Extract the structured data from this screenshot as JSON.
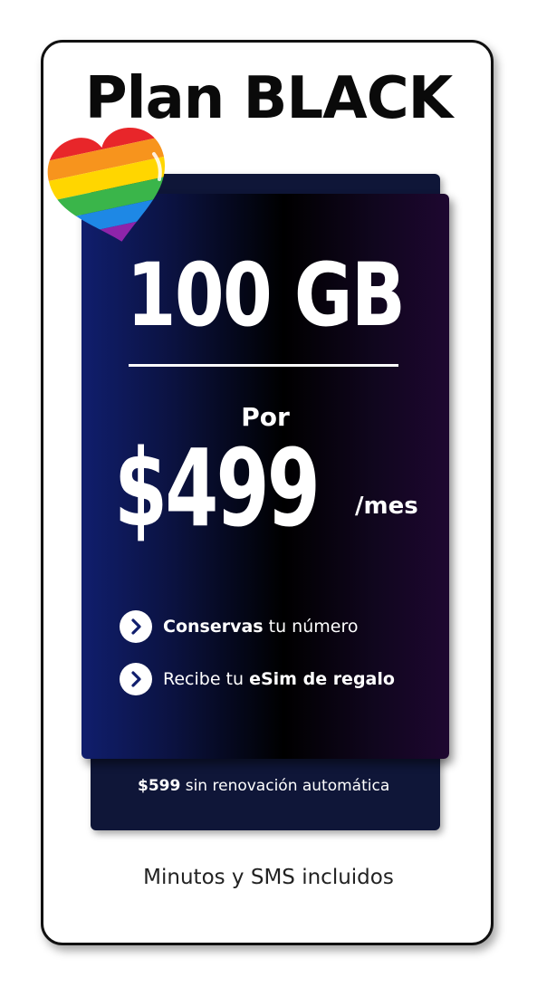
{
  "plan": {
    "title": "Plan BLACK",
    "data_amount": "100 GB",
    "price_prefix": "Por",
    "price": "$499",
    "price_period": "/mes",
    "features": [
      {
        "bold": "Conservas",
        "rest": " tu número",
        "icon": "chevron-right-icon"
      },
      {
        "pre": "Recibe tu ",
        "bold": "eSim de regalo",
        "icon": "chevron-right-icon"
      }
    ],
    "renewal": {
      "price": "$599",
      "text": " sin renovación automática"
    },
    "footer": "Minutos y SMS incluidos"
  },
  "badge": {
    "icon": "rainbow-heart-icon"
  },
  "colors": {
    "panel_gradient_start": "#101e6d",
    "panel_gradient_mid": "#000000",
    "panel_gradient_end": "#1e0730",
    "back_panel": "#0f1638",
    "text": "#ffffff",
    "title": "#0a0a0a"
  }
}
